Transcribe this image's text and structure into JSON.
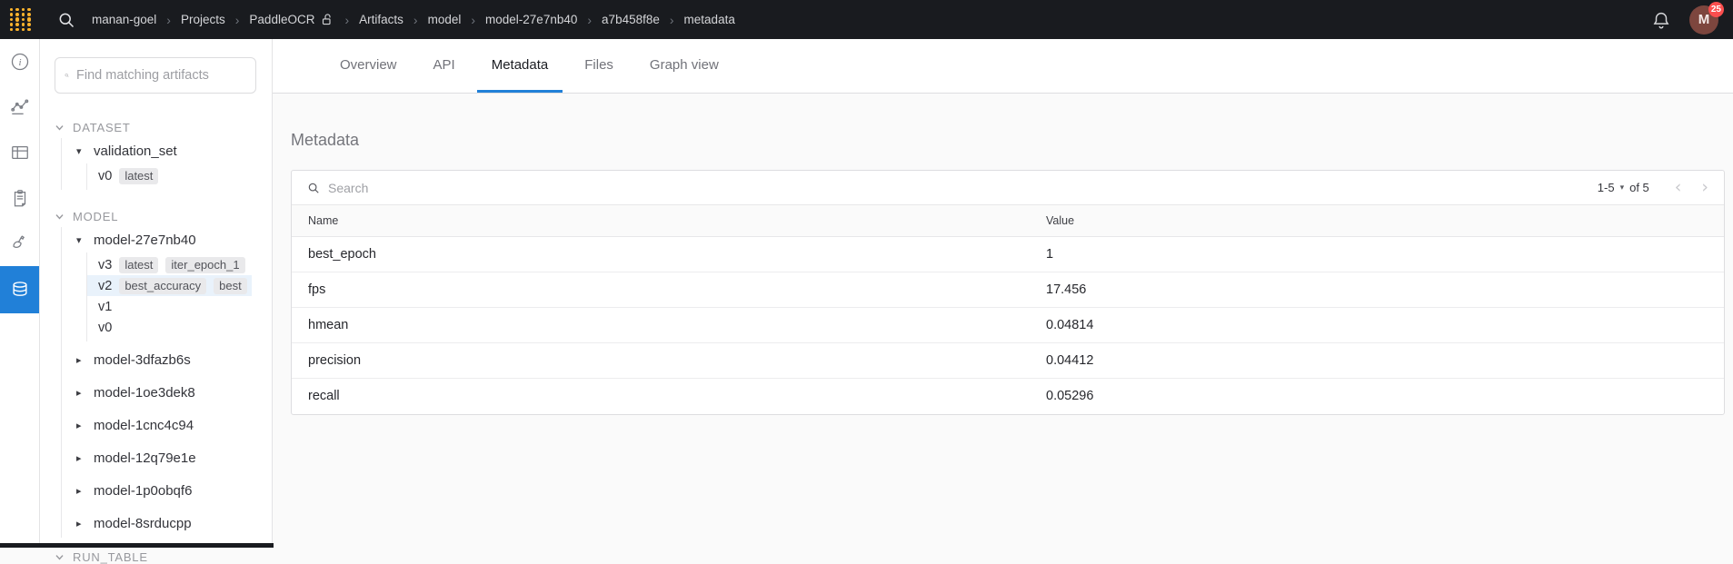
{
  "colors": {
    "navbar_bg": "#191b1f",
    "logo_gold": "#fcb32c",
    "accent_blue": "#2180d8",
    "badge_red": "#fb4e4e",
    "avatar_bg": "#7d463e",
    "selected_version_bg": "#e9f2fb"
  },
  "icons": {
    "caret_down": "▾",
    "caret_right": "▸",
    "breadcrumb_sep": "›",
    "chev_left": "‹",
    "chev_right": "›"
  },
  "navbar": {
    "breadcrumbs": [
      "manan-goel",
      "Projects",
      "PaddleOCR",
      "Artifacts",
      "model",
      "model-27e7nb40",
      "a7b458f8e",
      "metadata"
    ],
    "notification_count": "25",
    "avatar_initial": "M"
  },
  "sidebar": {
    "search_placeholder": "Find matching artifacts",
    "dataset_header": "DATASET",
    "validation_set": {
      "label": "validation_set",
      "v0": {
        "label": "v0",
        "badge": "latest"
      }
    },
    "model_header": "MODEL",
    "model_27e7nb40": {
      "label": "model-27e7nb40",
      "v3": {
        "label": "v3",
        "badge1": "latest",
        "badge2": "iter_epoch_1"
      },
      "v2": {
        "label": "v2",
        "badge1": "best_accuracy",
        "badge2": "best"
      },
      "v1": {
        "label": "v1"
      },
      "v0": {
        "label": "v0"
      }
    },
    "collapsed_models": [
      {
        "label": "model-3dfazb6s"
      },
      {
        "label": "model-1oe3dek8"
      },
      {
        "label": "model-1cnc4c94"
      },
      {
        "label": "model-12q79e1e"
      },
      {
        "label": "model-1p0obqf6"
      },
      {
        "label": "model-8srducpp"
      }
    ],
    "run_table_header": "RUN_TABLE"
  },
  "tabs": [
    {
      "label": "Overview"
    },
    {
      "label": "API"
    },
    {
      "label": "Metadata"
    },
    {
      "label": "Files"
    },
    {
      "label": "Graph view"
    }
  ],
  "main": {
    "heading": "Metadata",
    "search_placeholder": "Search",
    "pagination": {
      "range": "1-5",
      "total": "of 5"
    },
    "table": {
      "columns": {
        "name": "Name",
        "value": "Value"
      },
      "rows": [
        {
          "name": "best_epoch",
          "value": "1"
        },
        {
          "name": "fps",
          "value": "17.456"
        },
        {
          "name": "hmean",
          "value": "0.04814"
        },
        {
          "name": "precision",
          "value": "0.04412"
        },
        {
          "name": "recall",
          "value": "0.05296"
        }
      ]
    }
  }
}
